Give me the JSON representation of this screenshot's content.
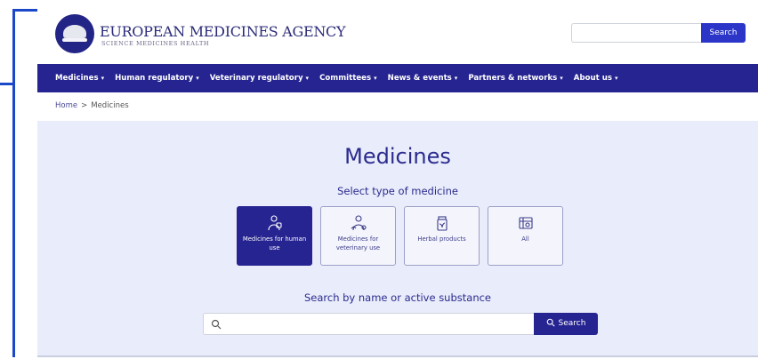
{
  "header": {
    "brand_title": "EUROPEAN MEDICINES AGENCY",
    "brand_subtitle": "SCIENCE  MEDICINES  HEALTH",
    "search_value": "",
    "search_button": "Search"
  },
  "nav": {
    "items": [
      {
        "label": "Medicines"
      },
      {
        "label": "Human regulatory"
      },
      {
        "label": "Veterinary regulatory"
      },
      {
        "label": "Committees"
      },
      {
        "label": "News & events"
      },
      {
        "label": "Partners & networks"
      },
      {
        "label": "About us"
      }
    ],
    "caret": "▾"
  },
  "breadcrumb": {
    "home": "Home",
    "separator": ">",
    "current": "Medicines"
  },
  "main": {
    "title": "Medicines",
    "select_label": "Select type of medicine",
    "cards": [
      {
        "label": "Medicines for human use",
        "icon": "human-medicine-icon",
        "selected": true
      },
      {
        "label": "Medicines for veterinary use",
        "icon": "veterinary-medicine-icon",
        "selected": false
      },
      {
        "label": "Herbal products",
        "icon": "herbal-product-icon",
        "selected": false
      },
      {
        "label": "All",
        "icon": "all-medicines-icon",
        "selected": false
      }
    ],
    "search_label": "Search by name or active substance",
    "search_value": "",
    "search_button": "Search"
  },
  "colors": {
    "nav_background": "#262491",
    "panel_background": "#e9ecfa",
    "accent_button": "#2b36c8",
    "annotation_bracket": "#1b47c9"
  }
}
